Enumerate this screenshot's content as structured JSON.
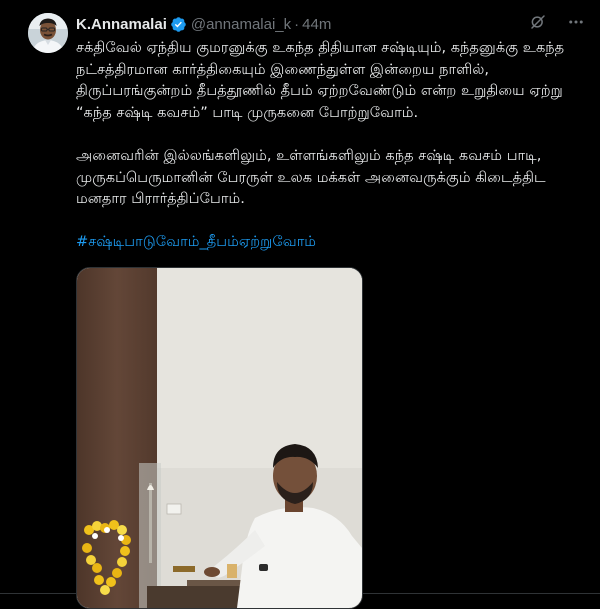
{
  "author": {
    "display_name": "K.Annamalai",
    "handle": "@annamalai_k",
    "separator": "·",
    "time": "44m",
    "verified_icon": "verified-badge-icon",
    "verified_color": "#1d9bf0"
  },
  "actions": {
    "grok_icon": "grok-icon",
    "more_icon": "more-horizontal-icon"
  },
  "post": {
    "paragraph1": "சக்திவேல் ஏந்திய குமரனுக்கு உகந்த திதியான சஷ்டியும், கந்தனுக்கு உகந்த நட்சத்திரமான கார்த்திகையும் இணைந்துள்ள இன்றைய நாளில், திருப்பரங்குன்றம் தீபத்தூணில் தீபம் ஏற்றவேண்டும் என்ற உறுதியை ஏற்று “கந்த சஷ்டி கவசம்” பாடி முருகனை போற்றுவோம்.",
    "paragraph2": "அனைவரின் இல்லங்களிலும், உள்ளங்களிலும் கந்த சஷ்டி கவசம் பாடி, முருகப்பெருமானின் பேரருள் உலக மக்கள் அனைவருக்கும் கிடைத்திட மனதார பிரார்த்திப்போம்.",
    "hashtag": "#சஷ்டிபாடுவோம்_தீபம்ஏற்றுவோம்"
  },
  "colors": {
    "background": "#000000",
    "text": "#e7e9ea",
    "secondary": "#71767b",
    "link": "#1d9bf0"
  }
}
